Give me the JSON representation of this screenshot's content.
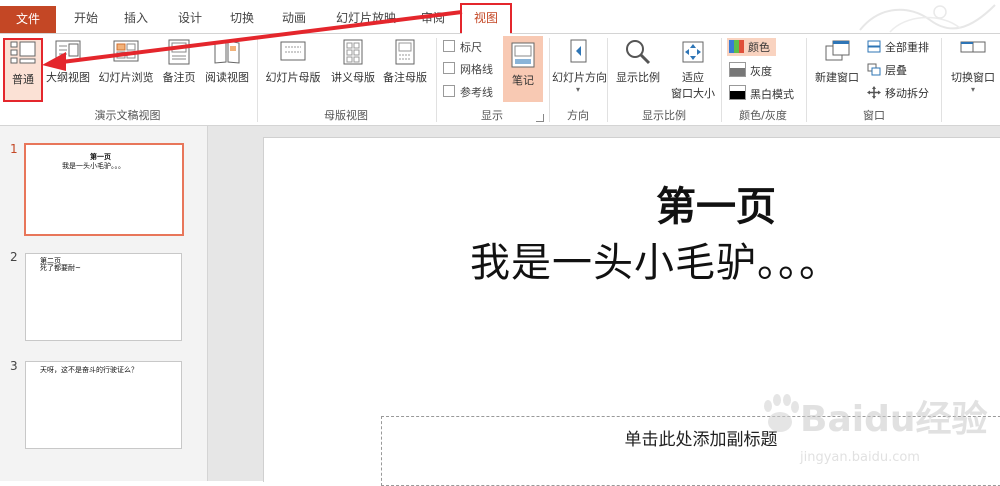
{
  "tabs": {
    "file": "文件",
    "home": "开始",
    "insert": "插入",
    "design": "设计",
    "transitions": "切换",
    "animations": "动画",
    "slideshow": "幻灯片放映",
    "review": "审阅",
    "view": "视图"
  },
  "ribbon": {
    "presentation_views": {
      "label": "演示文稿视图",
      "normal": "普通",
      "outline": "大纲视图",
      "sorter": "幻灯片浏览",
      "notes_page": "备注页",
      "reading": "阅读视图"
    },
    "master_views": {
      "label": "母版视图",
      "slide_master": "幻灯片母版",
      "handout_master": "讲义母版",
      "notes_master": "备注母版"
    },
    "show": {
      "label": "显示",
      "ruler": "标尺",
      "gridlines": "网格线",
      "guides": "参考线",
      "notes": "笔记"
    },
    "orientation": {
      "label": "方向",
      "slide_orientation": "幻灯片方向"
    },
    "zoom": {
      "label": "显示比例",
      "zoom": "显示比例",
      "fit_line1": "适应",
      "fit_line2": "窗口大小"
    },
    "color": {
      "label": "颜色/灰度",
      "color": "颜色",
      "grayscale": "灰度",
      "bw": "黑白模式"
    },
    "window": {
      "label": "窗口",
      "new_window": "新建窗口",
      "arrange_all": "全部重排",
      "cascade": "层叠",
      "move_split": "移动拆分",
      "switch_windows": "切换窗口"
    }
  },
  "thumbnails": [
    {
      "num": "1",
      "line1": "第一页",
      "line2": "我是一头小毛驴。。。"
    },
    {
      "num": "2",
      "line1": "第二页",
      "line2": "死了都要耐~"
    },
    {
      "num": "3",
      "line1": "天呀，这不是奋斗的行驶证么？",
      "line2": ""
    }
  ],
  "slide": {
    "title": "第一页",
    "line2": "我是一头小毛驴。。。",
    "subtitle_placeholder": "单击此处添加副标题"
  },
  "watermark": {
    "text": "Baidu经验",
    "url": "jingyan.baidu.com"
  },
  "colors": {
    "accent": "#c44725",
    "highlight_red": "#e4262c",
    "selected_fill": "#f8c9b3"
  }
}
